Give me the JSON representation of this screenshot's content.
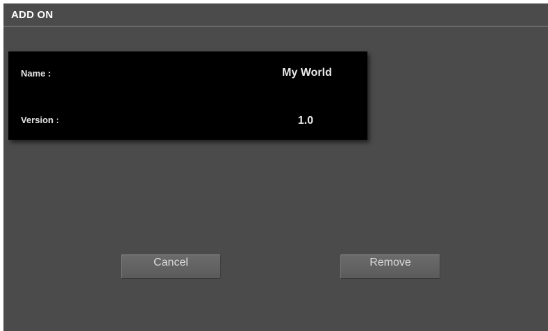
{
  "dialog": {
    "title": "ADD ON"
  },
  "info": {
    "name_label": "Name :",
    "name_value": "My World",
    "version_label": "Version :",
    "version_value": "1.0"
  },
  "buttons": {
    "cancel_label": "Cancel",
    "remove_label": "Remove"
  },
  "colors": {
    "dialog_background": "#4b4b4b",
    "panel_background": "#000000",
    "button_background": "#636363",
    "text": "#e6e6e6"
  }
}
